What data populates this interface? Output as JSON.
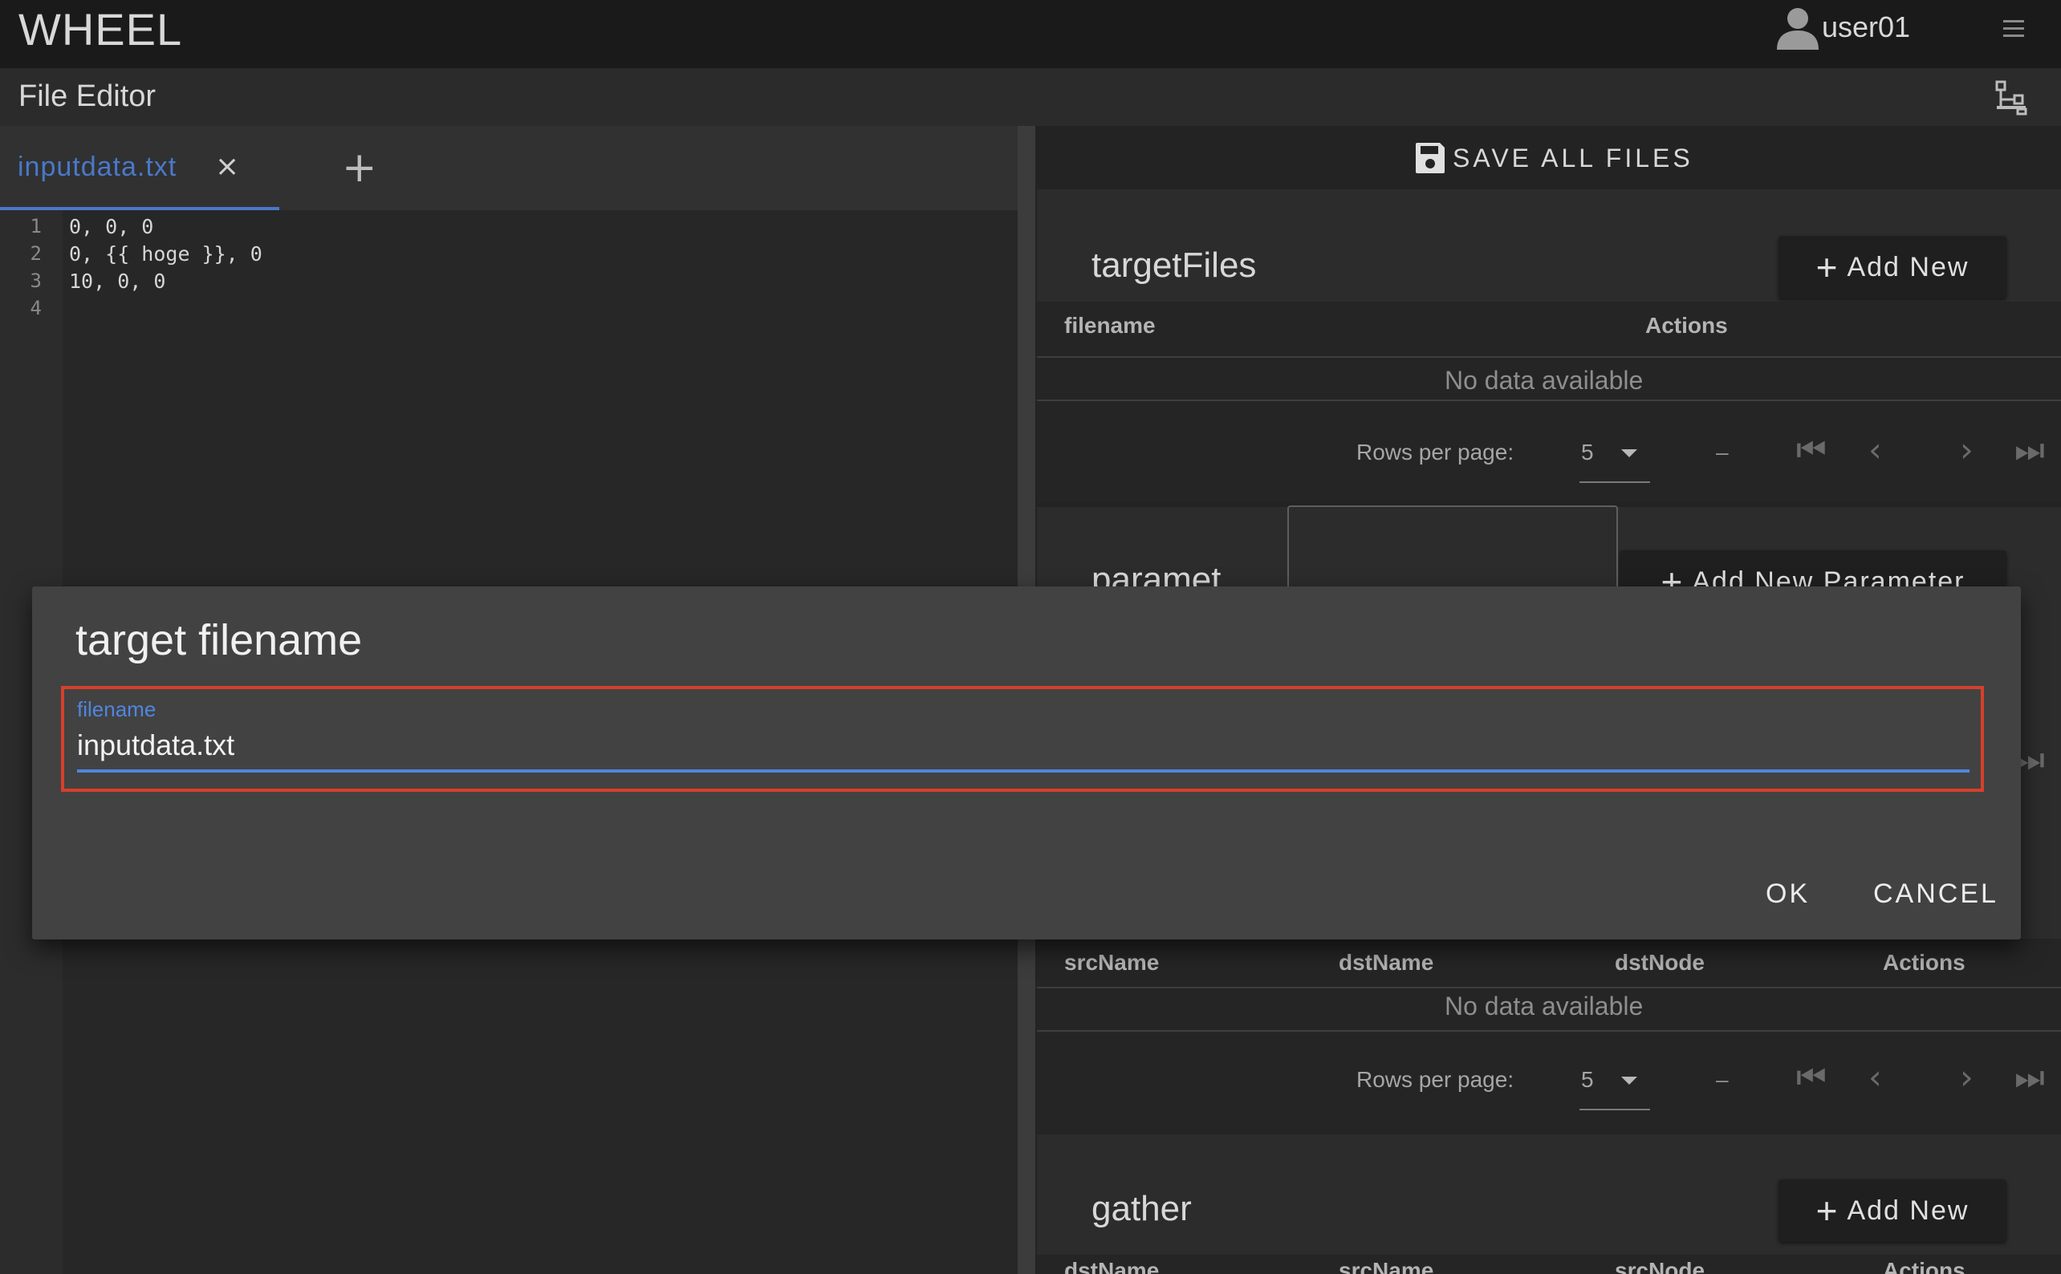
{
  "app": {
    "title": "WHEEL",
    "user": "user01"
  },
  "subheader": {
    "title": "File Editor"
  },
  "editor": {
    "tabs": [
      {
        "label": "inputdata.txt",
        "close": "×"
      }
    ],
    "add_tab": "+",
    "line_numbers": [
      "1",
      "2",
      "3",
      "4"
    ],
    "lines": [
      "0, 0, 0",
      "0, {{ hoge }}, 0",
      "10, 0, 0",
      ""
    ]
  },
  "right": {
    "save_all": "SAVE ALL FILES",
    "target_files": {
      "title": "targetFiles",
      "add_label": "Add New",
      "headers": [
        "filename",
        "Actions"
      ],
      "empty": "No data available",
      "rows_per_page_label": "Rows per page:",
      "rows_per_page": "5",
      "range": "–"
    },
    "parameters": {
      "title": "paramet...",
      "add_label": "Add New Parameter"
    },
    "scatter": {
      "headers": [
        "srcName",
        "dstName",
        "dstNode",
        "Actions"
      ],
      "empty": "No data available",
      "rows_per_page_label": "Rows per page:",
      "rows_per_page": "5",
      "range": "–"
    },
    "gather": {
      "title": "gather",
      "add_label": "Add New",
      "headers": [
        "dstName",
        "srcName",
        "srcNode",
        "Actions"
      ]
    }
  },
  "dialog": {
    "title": "target filename",
    "field_label": "filename",
    "field_value": "inputdata.txt",
    "ok": "OK",
    "cancel": "CANCEL"
  },
  "colors": {
    "accent": "#4f86e0",
    "highlight_border": "#d6402a",
    "appbar": "#1a1a1a",
    "dialog": "#424242"
  },
  "icons": [
    "account-icon",
    "menu-icon",
    "graph-view-icon",
    "save-icon",
    "plus-icon",
    "close-icon",
    "first-page-icon",
    "prev-page-icon",
    "next-page-icon",
    "last-page-icon",
    "dropdown-caret-icon"
  ]
}
